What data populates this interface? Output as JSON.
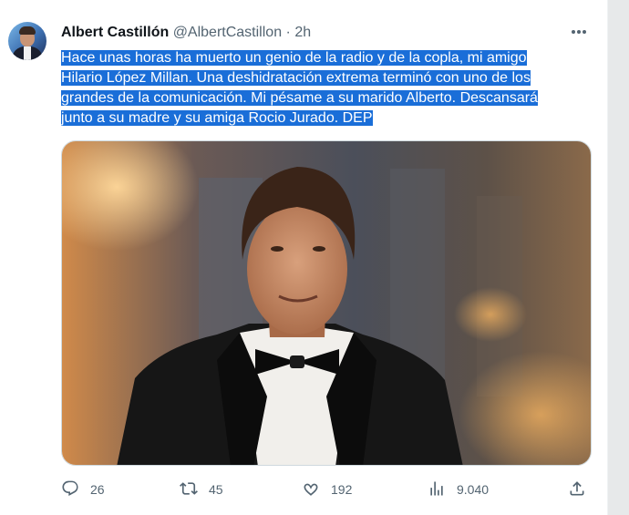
{
  "tweet": {
    "display_name": "Albert Castillón",
    "handle": "@AlbertCastillon",
    "separator": "·",
    "timestamp": "2h",
    "text_lines": [
      "Hace unas horas ha muerto un genio de la radio y de la copla, mi amigo",
      "Hilario López Millan. Una deshidratación extrema terminó con uno de los",
      "grandes de la comunicación. Mi pésame a su marido Alberto. Descansará",
      "junto a su madre y su amiga Rocio Jurado. DEP"
    ],
    "text_selected": true,
    "selection_color": "#1a6ed8"
  },
  "actions": {
    "replies": "26",
    "retweets": "45",
    "likes": "192",
    "views": "9.040"
  },
  "icons": {
    "avatar": "profile-photo",
    "more": "more-horizontal-icon",
    "reply": "reply-icon",
    "retweet": "retweet-icon",
    "like": "heart-icon",
    "views": "analytics-icon",
    "share": "share-icon"
  }
}
